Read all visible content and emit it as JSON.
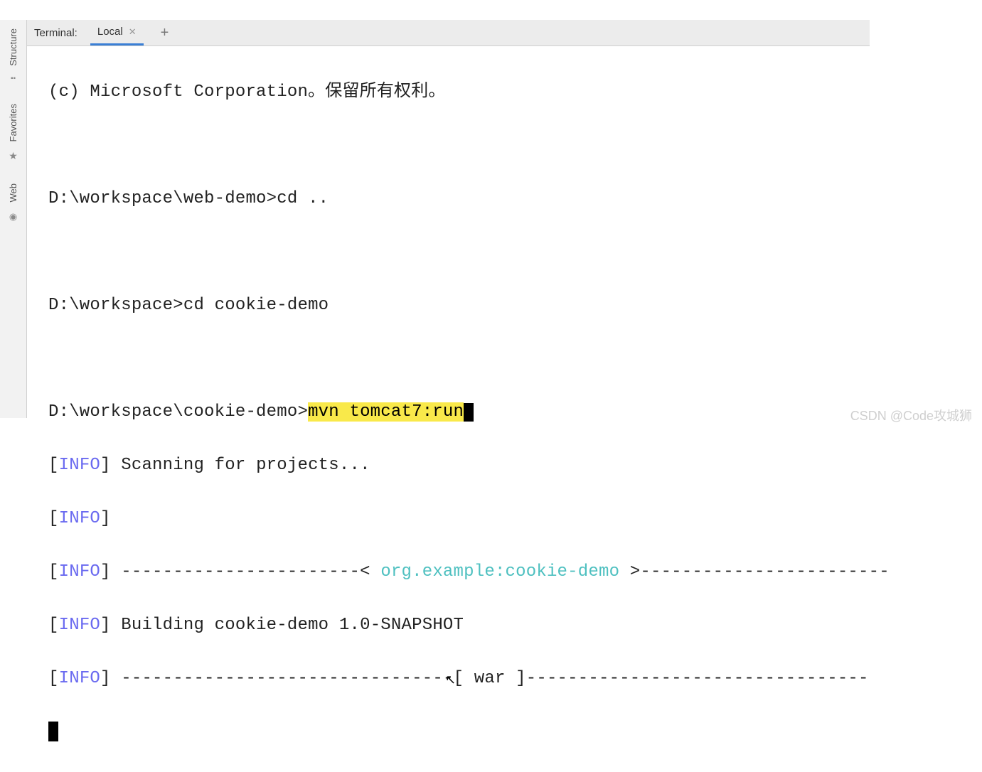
{
  "sidebar": {
    "structure_label": "Structure",
    "favorites_label": "Favorites",
    "web_label": "Web"
  },
  "terminal": {
    "panel_label": "Terminal:",
    "tab_label": "Local",
    "add_symbol": "+"
  },
  "console": {
    "copyright": "(c) Microsoft Corporation。保留所有权利。",
    "prompt1_path": "D:\\workspace\\web-demo>",
    "cmd1": "cd ..",
    "prompt2_path": "D:\\workspace>",
    "cmd2": "cd cookie-demo",
    "prompt3_path": "D:\\workspace\\cookie-demo>",
    "cmd3_highlighted": "mvn tomcat7:run",
    "open_bracket": "[",
    "info_tag": "INFO",
    "close_bracket": "]",
    "scanning": " Scanning for projects...",
    "dashes_left_artifact": " -----------------------< ",
    "artifact_id": "org.example:cookie-demo",
    "dashes_right_artifact": " >------------------------",
    "building": " Building cookie-demo 1.0-SNAPSHOT",
    "dashes_left_war": " --------------------------------[ ",
    "war_label": "war",
    "dashes_right_war": " ]---------------------------------"
  },
  "watermark": "CSDN @Code攻城狮"
}
